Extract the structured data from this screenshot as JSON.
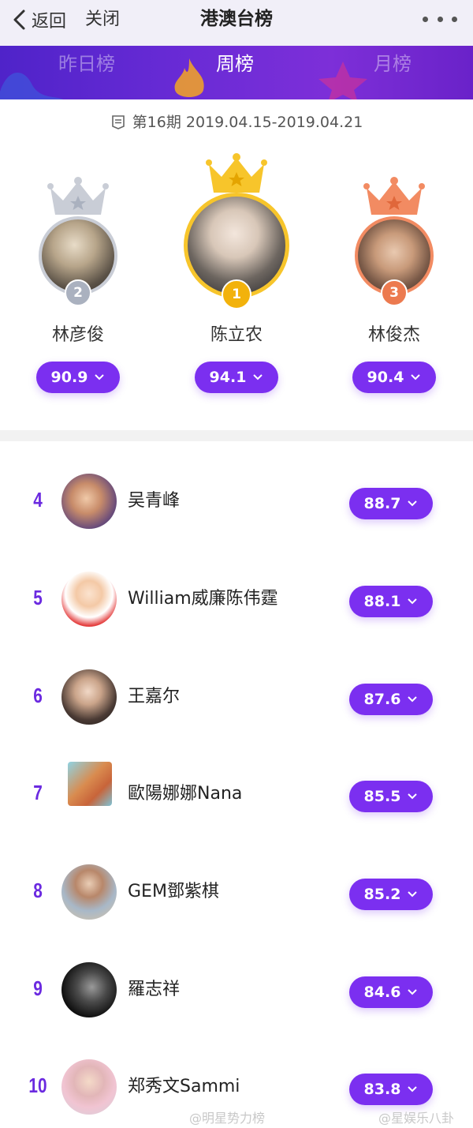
{
  "navbar": {
    "back_label": "返回",
    "close_label": "关闭",
    "title": "港澳台榜",
    "more_icon": "more-dots-icon"
  },
  "tabs": [
    {
      "label": "昨日榜",
      "active": false
    },
    {
      "label": "周榜",
      "active": true
    },
    {
      "label": "月榜",
      "active": false
    }
  ],
  "period": {
    "icon": "calendar-icon",
    "text": "第16期 2019.04.15-2019.04.21"
  },
  "podium": [
    {
      "rank": "2",
      "name": "林彦俊",
      "score": "90.9",
      "crown_color": "#c9cdd6",
      "badge_color": "#aab1bf"
    },
    {
      "rank": "1",
      "name": "陈立农",
      "score": "94.1",
      "crown_color": "#f7c52b",
      "badge_color": "#f2b20c"
    },
    {
      "rank": "3",
      "name": "林俊杰",
      "score": "90.4",
      "crown_color": "#f28b62",
      "badge_color": "#ec7a4f"
    }
  ],
  "list": [
    {
      "rank": "4",
      "name": "吴青峰",
      "score": "88.7"
    },
    {
      "rank": "5",
      "name": "William威廉陈伟霆",
      "score": "88.1"
    },
    {
      "rank": "6",
      "name": "王嘉尔",
      "score": "87.6"
    },
    {
      "rank": "7",
      "name": "歐陽娜娜Nana",
      "score": "85.5"
    },
    {
      "rank": "8",
      "name": "GEM鄧紫棋",
      "score": "85.2"
    },
    {
      "rank": "9",
      "name": "羅志祥",
      "score": "84.6"
    },
    {
      "rank": "10",
      "name": "郑秀文Sammi",
      "score": "83.8"
    }
  ],
  "watermarks": [
    "@明星势力榜",
    "@星娱乐八卦"
  ],
  "colors": {
    "accent": "#7b2ff0",
    "tabbar": "#5a25cc"
  }
}
